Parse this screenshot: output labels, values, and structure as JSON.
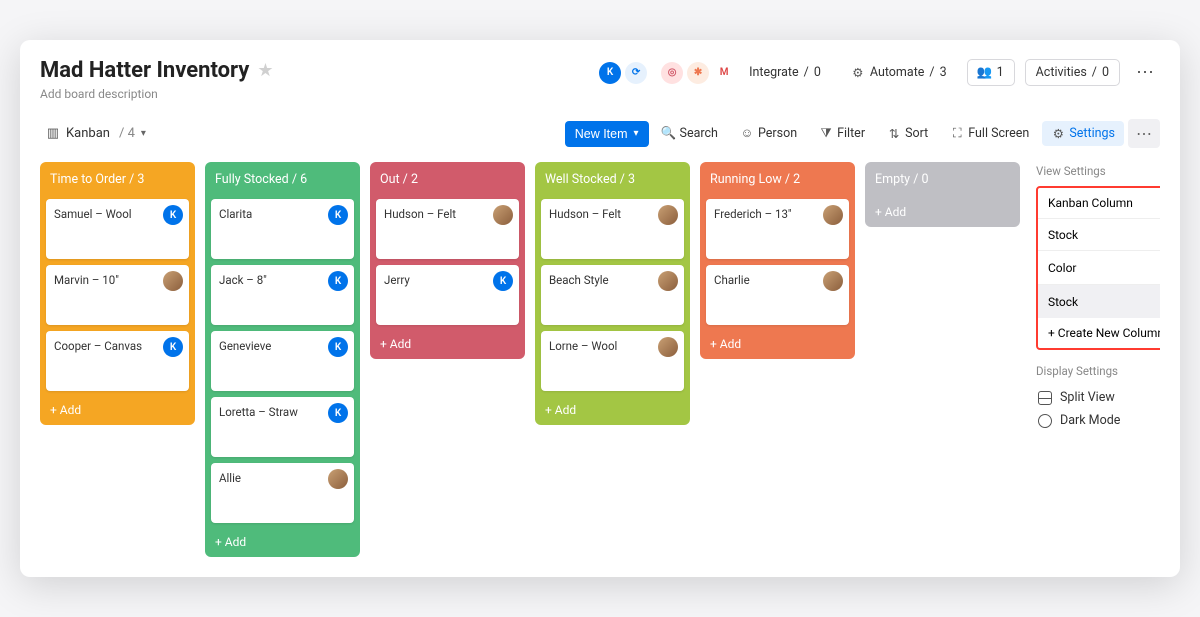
{
  "header": {
    "title": "Mad Hatter Inventory",
    "description": "Add board description",
    "integrate_label": "Integrate",
    "integrate_count": 0,
    "automate_label": "Automate",
    "automate_count": 3,
    "members_count": 1,
    "activities_label": "Activities",
    "activities_count": 0
  },
  "toolbar": {
    "view_label": "Kanban",
    "view_count": 4,
    "new_item": "New Item",
    "search": "Search",
    "person": "Person",
    "filter": "Filter",
    "sort": "Sort",
    "full_screen": "Full Screen",
    "settings": "Settings"
  },
  "columns": [
    {
      "name": "Time to Order",
      "count": 3,
      "color": "#f5a623",
      "cards": [
        {
          "title": "Samuel – Wool",
          "avatar": "letter"
        },
        {
          "title": "Marvin – 10\"",
          "avatar": "photo"
        },
        {
          "title": "Cooper – Canvas",
          "avatar": "letter"
        }
      ]
    },
    {
      "name": "Fully Stocked",
      "count": 6,
      "color": "#4fbb7b",
      "cards": [
        {
          "title": "Clarita",
          "avatar": "letter"
        },
        {
          "title": "Jack – 8\"",
          "avatar": "letter"
        },
        {
          "title": "Genevieve",
          "avatar": "letter"
        },
        {
          "title": "Loretta – Straw",
          "avatar": "letter"
        },
        {
          "title": "Allie",
          "avatar": "photo"
        }
      ]
    },
    {
      "name": "Out",
      "count": 2,
      "color": "#d15b6b",
      "cards": [
        {
          "title": "Hudson – Felt",
          "avatar": "photo"
        },
        {
          "title": "Jerry",
          "avatar": "letter"
        }
      ]
    },
    {
      "name": "Well Stocked",
      "count": 3,
      "color": "#a3c644",
      "cards": [
        {
          "title": "Hudson – Felt",
          "avatar": "photo"
        },
        {
          "title": "Beach Style",
          "avatar": "photo"
        },
        {
          "title": "Lorne – Wool",
          "avatar": "photo"
        }
      ]
    },
    {
      "name": "Running Low",
      "count": 2,
      "color": "#ee7850",
      "cards": [
        {
          "title": "Frederich – 13\"",
          "avatar": "photo"
        },
        {
          "title": "Charlie",
          "avatar": "photo"
        }
      ]
    },
    {
      "name": "Empty",
      "count": 0,
      "color": "#bfbfc4",
      "cards": []
    }
  ],
  "add_label": "+ Add",
  "settings_panel": {
    "view_h": "View Settings",
    "kanban_col": "Kanban Column",
    "selected": "Stock",
    "options": [
      {
        "label": "Color",
        "selected": false
      },
      {
        "label": "Stock",
        "selected": true
      }
    ],
    "create_new": "+ Create New Column",
    "display_h": "Display Settings",
    "split_view": "Split View",
    "dark_mode": "Dark Mode"
  }
}
